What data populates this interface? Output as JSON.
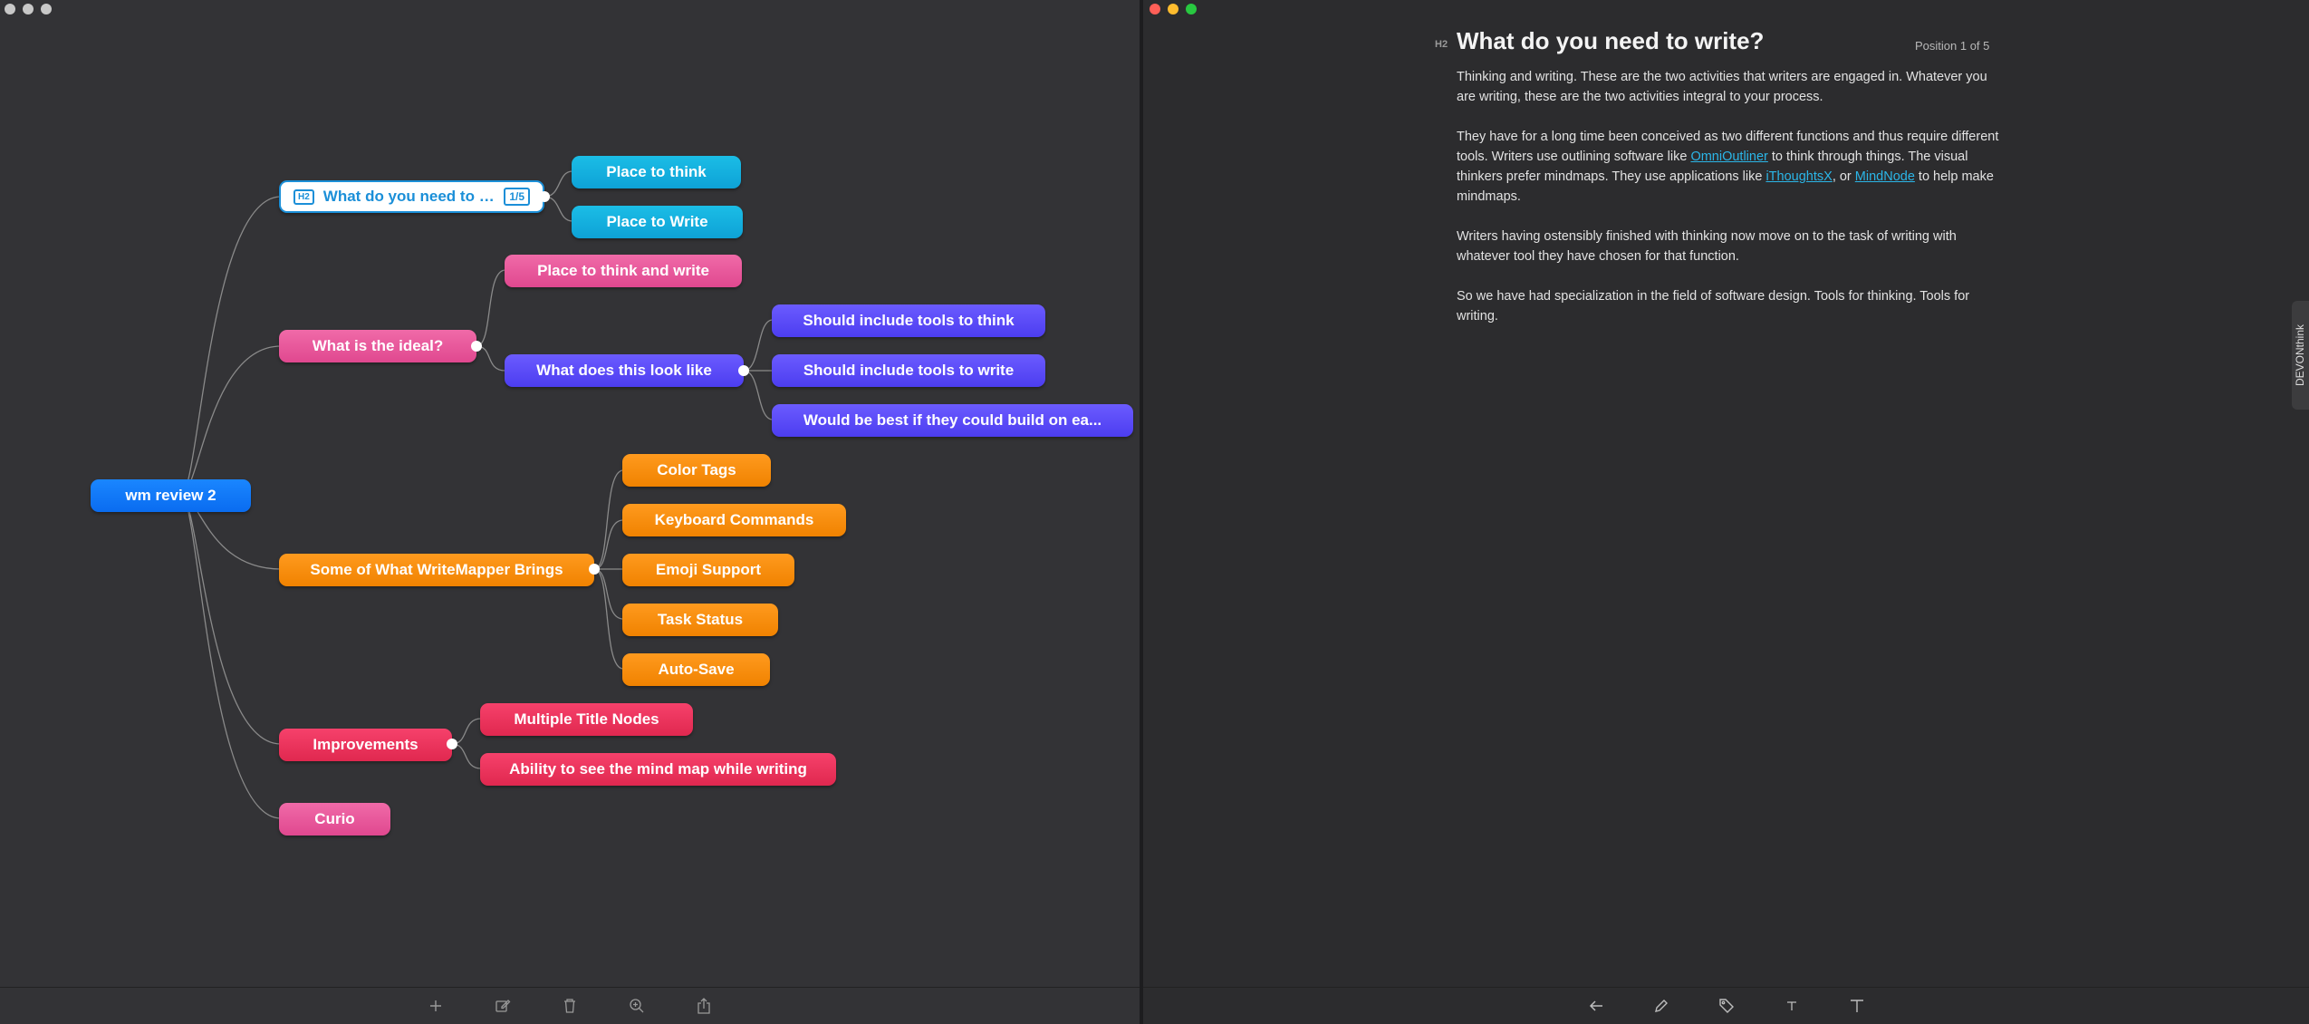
{
  "left_window": {
    "traffic_lights": [
      "#c8c8c8",
      "#c8c8c8",
      "#c8c8c8"
    ]
  },
  "right_window": {
    "traffic_lights": [
      "#ff5f57",
      "#febc2e",
      "#28c840"
    ]
  },
  "mindmap": {
    "root": "wm review 2",
    "selected_node": {
      "badge": "H2",
      "label": "What do you need to write?",
      "position_badge": "1/5"
    },
    "nodes": {
      "place_to_think": "Place to think",
      "place_to_write": "Place to Write",
      "what_is_ideal": "What is the ideal?",
      "place_think_write": "Place to think and write",
      "what_look_like": "What does this look like",
      "tools_think": "Should include tools to think",
      "tools_write": "Should include tools to write",
      "build_on": "Would be best if they could build on ea...",
      "writemapper_brings": "Some of What WriteMapper Brings",
      "color_tags": "Color Tags",
      "keyboard_commands": "Keyboard Commands",
      "emoji_support": "Emoji Support",
      "task_status": "Task Status",
      "auto_save": "Auto-Save",
      "improvements": "Improvements",
      "multiple_title": "Multiple Title Nodes",
      "see_map": "Ability to see the mind map while writing",
      "curio": "Curio"
    },
    "colors": {
      "root": "#0a6cf0",
      "cyan": "#0ea2d6",
      "pink": "#e0488f",
      "purple": "#4c3df0",
      "orange": "#f08200",
      "red": "#e0284f"
    }
  },
  "left_toolbar": {
    "icons": [
      "plus-icon",
      "edit-icon",
      "trash-icon",
      "zoom-icon",
      "share-icon"
    ]
  },
  "editor": {
    "heading_level": "H2",
    "title": "What do you need to write?",
    "position": "Position 1 of 5",
    "paragraphs": {
      "p1": "Thinking and writing. These are the two activities that writers are engaged in. Whatever you are writing, these are the two activities integral to your process.",
      "p2_a": "They have for a long time been conceived as two different functions and thus require different tools. Writers use outlining software like ",
      "p2_link1": "OmniOutliner",
      "p2_b": " to think through things. The visual thinkers prefer mindmaps. They use applications like ",
      "p2_link2": "iThoughtsX",
      "p2_c": ", or ",
      "p2_link3": "MindNode",
      "p2_d": " to help make mindmaps.",
      "p3": "Writers having ostensibly finished with thinking now move on to the task of writing with whatever tool they have chosen for that function.",
      "p4": "So we have had specialization in the field of software design. Tools for thinking. Tools for writing."
    }
  },
  "right_toolbar": {
    "icons": [
      "back-arrow-icon",
      "pencil-icon",
      "tag-icon",
      "text-small-icon",
      "text-large-icon"
    ]
  },
  "side_tab": {
    "label": "DEVONthink"
  }
}
